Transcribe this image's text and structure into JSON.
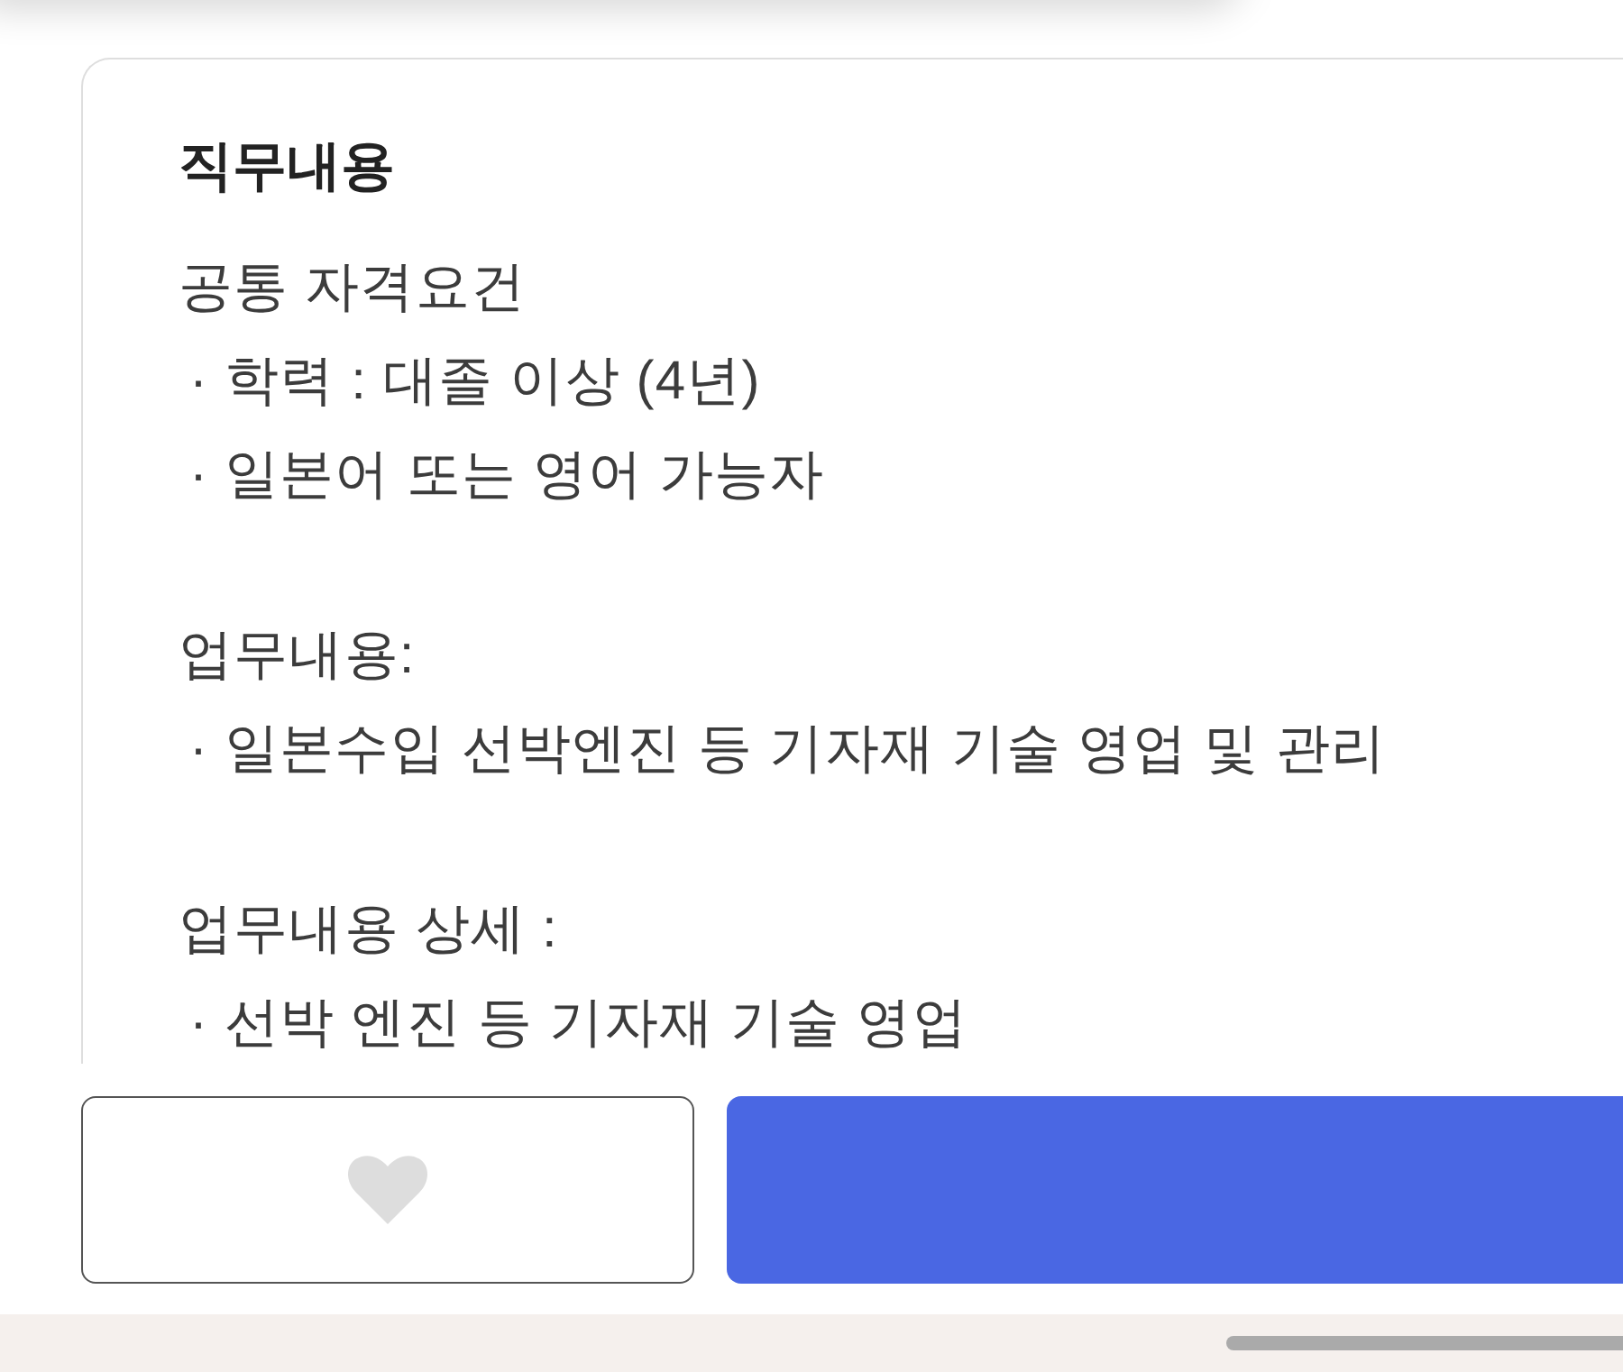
{
  "job_description": {
    "title": "직무내용",
    "sections": [
      {
        "heading": "공통 자격요건",
        "items": [
          "· 학력 : 대졸 이상 (4년)",
          "· 일본어 또는 영어 가능자"
        ]
      },
      {
        "heading": "업무내용:",
        "items": [
          "· 일본수입 선박엔진 등 기자재 기술 영업 및 관리"
        ]
      },
      {
        "heading": "업무내용 상세 :",
        "items": [
          "· 선박 엔진 등 기자재 기술 영업"
        ]
      }
    ]
  },
  "action_bar": {
    "favorite": {
      "favorited": false
    }
  }
}
